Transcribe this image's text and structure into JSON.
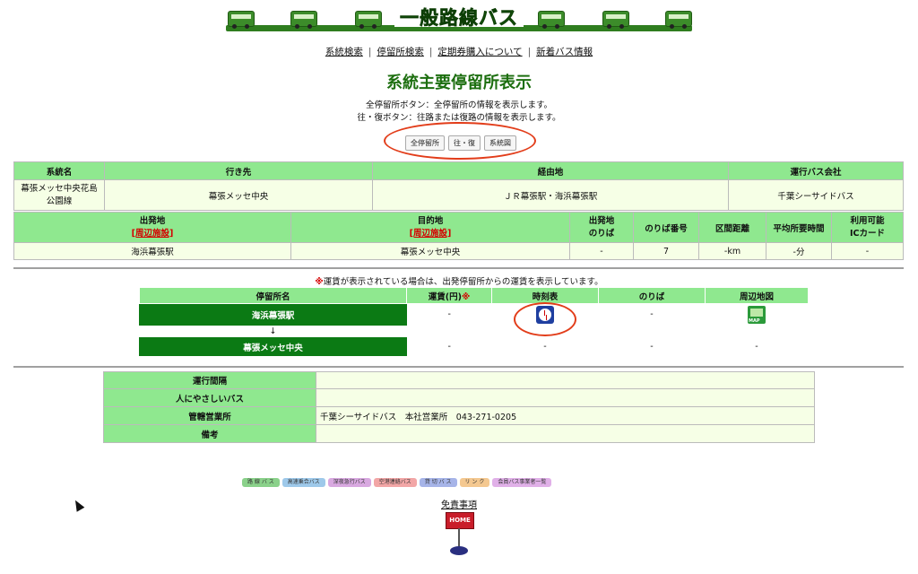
{
  "banner": {
    "title": "一般路線バス"
  },
  "nav": [
    {
      "label": "系統検索"
    },
    {
      "label": "停留所検索"
    },
    {
      "label": "定期券購入について"
    },
    {
      "label": "新着バス情報"
    }
  ],
  "page_title": "系統主要停留所表示",
  "desc": {
    "line1": "全停留所ボタン：全停留所の情報を表示します。",
    "line2": "往・復ボタン：往路または復路の情報を表示します。"
  },
  "buttons": {
    "all_stops": "全停留所",
    "round_trip": "往・復",
    "route_map": "系統図"
  },
  "route_table": {
    "headers": [
      "系統名",
      "行き先",
      "経由地",
      "運行バス会社"
    ],
    "row": [
      "幕張メッセ中央花島公園線",
      "幕張メッセ中央",
      "ＪＲ幕張駅・海浜幕張駅",
      "千葉シーサイドバス"
    ]
  },
  "trip_table": {
    "headers": {
      "origin": "出発地",
      "origin_link": "[周辺施設]",
      "dest": "目的地",
      "dest_link": "[周辺施設]",
      "platform1": "出発地",
      "platform2": "のりば",
      "platform_no": "のりば番号",
      "distance": "区間距離",
      "avg_time": "平均所要時間",
      "ic1": "利用可能",
      "ic2": "ICカード"
    },
    "row": {
      "origin": "海浜幕張駅",
      "dest": "幕張メッセ中央",
      "platform": "-",
      "platform_no": "7",
      "distance": "-km",
      "avg_time": "-分",
      "ic": "-"
    }
  },
  "fare_note": {
    "mark": "※",
    "text": "運賃が表示されている場合は、出発停留所からの運賃を表示しています。"
  },
  "stop_table": {
    "headers": {
      "name": "停留所名",
      "fare": "運賃(円)",
      "fare_mark": "※",
      "timetable": "時刻表",
      "platform": "のりば",
      "map": "周辺地図"
    },
    "arrow": "↓",
    "rows": [
      {
        "name": "海浜幕張駅",
        "fare": "-",
        "timetable": "",
        "platform": "-",
        "map_label": "MAP"
      },
      {
        "name": "幕張メッセ中央",
        "fare": "-",
        "timetable": "-",
        "platform": "-",
        "map": "-"
      }
    ]
  },
  "info_table": {
    "rows": [
      {
        "label": "運行間隔",
        "value": ""
      },
      {
        "label": "人にやさしいバス",
        "value": ""
      },
      {
        "label": "管轄営業所",
        "value": "千葉シーサイドバス　本社営業所　043-271-0205"
      },
      {
        "label": "備考",
        "value": ""
      }
    ]
  },
  "footer_buttons": [
    {
      "label": "路 線 バ ス",
      "color": "#8ad18a"
    },
    {
      "label": "高速乗合バス",
      "color": "#9ec9ea"
    },
    {
      "label": "深夜急行バス",
      "color": "#d8a8e0"
    },
    {
      "label": "空港連絡バス",
      "color": "#f2a6a6"
    },
    {
      "label": "貸 切 バ ス",
      "color": "#a6b4e8"
    },
    {
      "label": "リ ン ク",
      "color": "#f4c890"
    },
    {
      "label": "会員バス事業者一覧",
      "color": "#e0b0e8"
    }
  ],
  "disclaimer": "免責事項",
  "home_label": "HOME",
  "colors": {
    "header_green": "#8fe88f",
    "title_green": "#1c6e0f",
    "stop_green": "#0b7a14",
    "red": "#d40000",
    "annotation": "#e23d1a"
  }
}
